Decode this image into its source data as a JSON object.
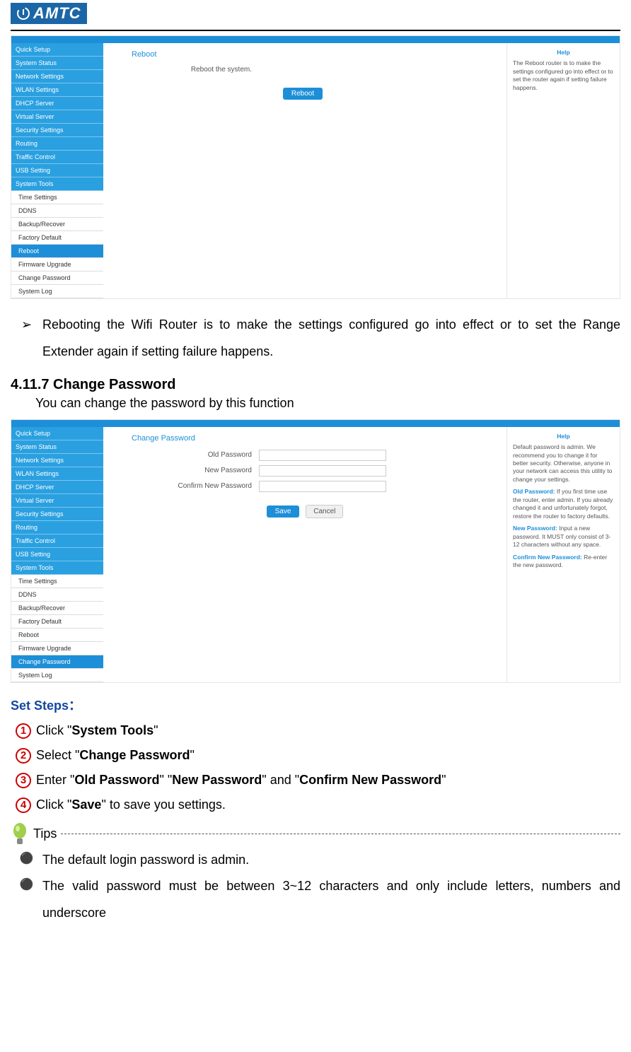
{
  "brand": {
    "name": "AMTC"
  },
  "screenshot1": {
    "nav": [
      "Quick Setup",
      "System Status",
      "Network Settings",
      "WLAN Settings",
      "DHCP Server",
      "Virtual Server",
      "Security Settings",
      "Routing",
      "Traffic Control",
      "USB Setting",
      "System Tools"
    ],
    "subnav": [
      "Time Settings",
      "DDNS",
      "Backup/Recover",
      "Factory Default",
      "Reboot",
      "Firmware Upgrade",
      "Change Password",
      "System Log"
    ],
    "subnav_selected": "Reboot",
    "main_title": "Reboot",
    "main_text": "Reboot the system.",
    "button": "Reboot",
    "help_title": "Help",
    "help_text": "The Reboot router is to make the settings configured go into effect or to set the router again if setting failure happens."
  },
  "bullet_reboot": "Rebooting the Wifi Router is to make the settings configured go into effect or to set the Range Extender again if setting failure happens.",
  "section_head": "4.11.7 Change Password",
  "section_sub": "You can change the password by this function",
  "screenshot2": {
    "main_title": "Change Password",
    "fields": {
      "old": "Old Password",
      "new": "New Password",
      "confirm": "Confirm New Password"
    },
    "save": "Save",
    "cancel": "Cancel",
    "subnav_selected": "Change Password",
    "help_title": "Help",
    "help_intro": "Default password is admin. We recommend you to change it for better security. Otherwise, anyone in your network can access this utility to change your settings.",
    "help_old_label": "Old Password:",
    "help_old": " If you first time use the router, enter admin. If you already changed it and unfortunately forgot, restore the router to factory defaults.",
    "help_new_label": "New Password:",
    "help_new": " Input a new password. It MUST only consist of 3-12 characters without any space.",
    "help_confirm_label": "Confirm New Password:",
    "help_confirm": " Re-enter the new password."
  },
  "set_steps": "Set Steps：",
  "steps": {
    "s1a": "Click \"",
    "s1b": "System Tools",
    "s1c": "\"",
    "s2a": "Select \"",
    "s2b": "Change Password",
    "s2c": "\"",
    "s3a": "Enter \"",
    "s3b": "Old Password",
    "s3c": "\" \"",
    "s3d": "New Password",
    "s3e": "\" and \"",
    "s3f": "Confirm New Password",
    "s3g": "\"",
    "s4a": "Click \"",
    "s4b": "Save",
    "s4c": "\" to save you settings."
  },
  "tips_label": "Tips",
  "tips": {
    "t1": "The default login password is admin.",
    "t2": "The valid password must be between 3~12 characters and only include letters, numbers and underscore"
  }
}
